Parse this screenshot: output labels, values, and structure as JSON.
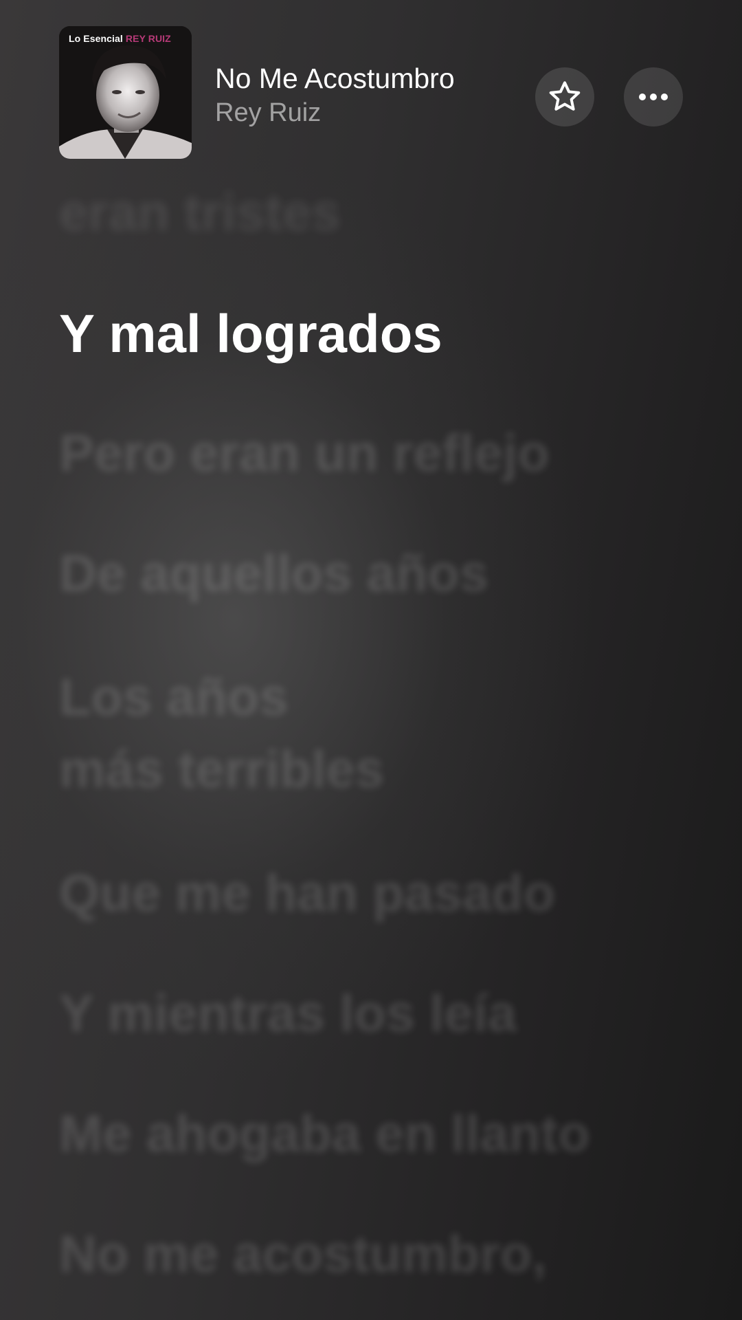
{
  "now_playing": {
    "artwork_caption_prefix": "Lo Esencial",
    "artwork_caption_accent": "REY RUIZ",
    "title": "No Me Acostumbro",
    "artist": "Rey Ruiz"
  },
  "actions": {
    "favorite_icon": "star-icon",
    "more_icon": "ellipsis-icon"
  },
  "lyrics": {
    "previous": "eran tristes",
    "current": "Y mal logrados",
    "upcoming": [
      "Pero eran un reflejo",
      "De aquellos años",
      "Los años",
      "más terribles",
      "Que me han pasado",
      "Y mientras los leía",
      "Me ahogaba en llanto",
      "No me acostumbro,"
    ]
  },
  "colors": {
    "text_primary": "#ffffff",
    "text_secondary": "#9a9a9a",
    "caption_accent": "#b73a78"
  }
}
